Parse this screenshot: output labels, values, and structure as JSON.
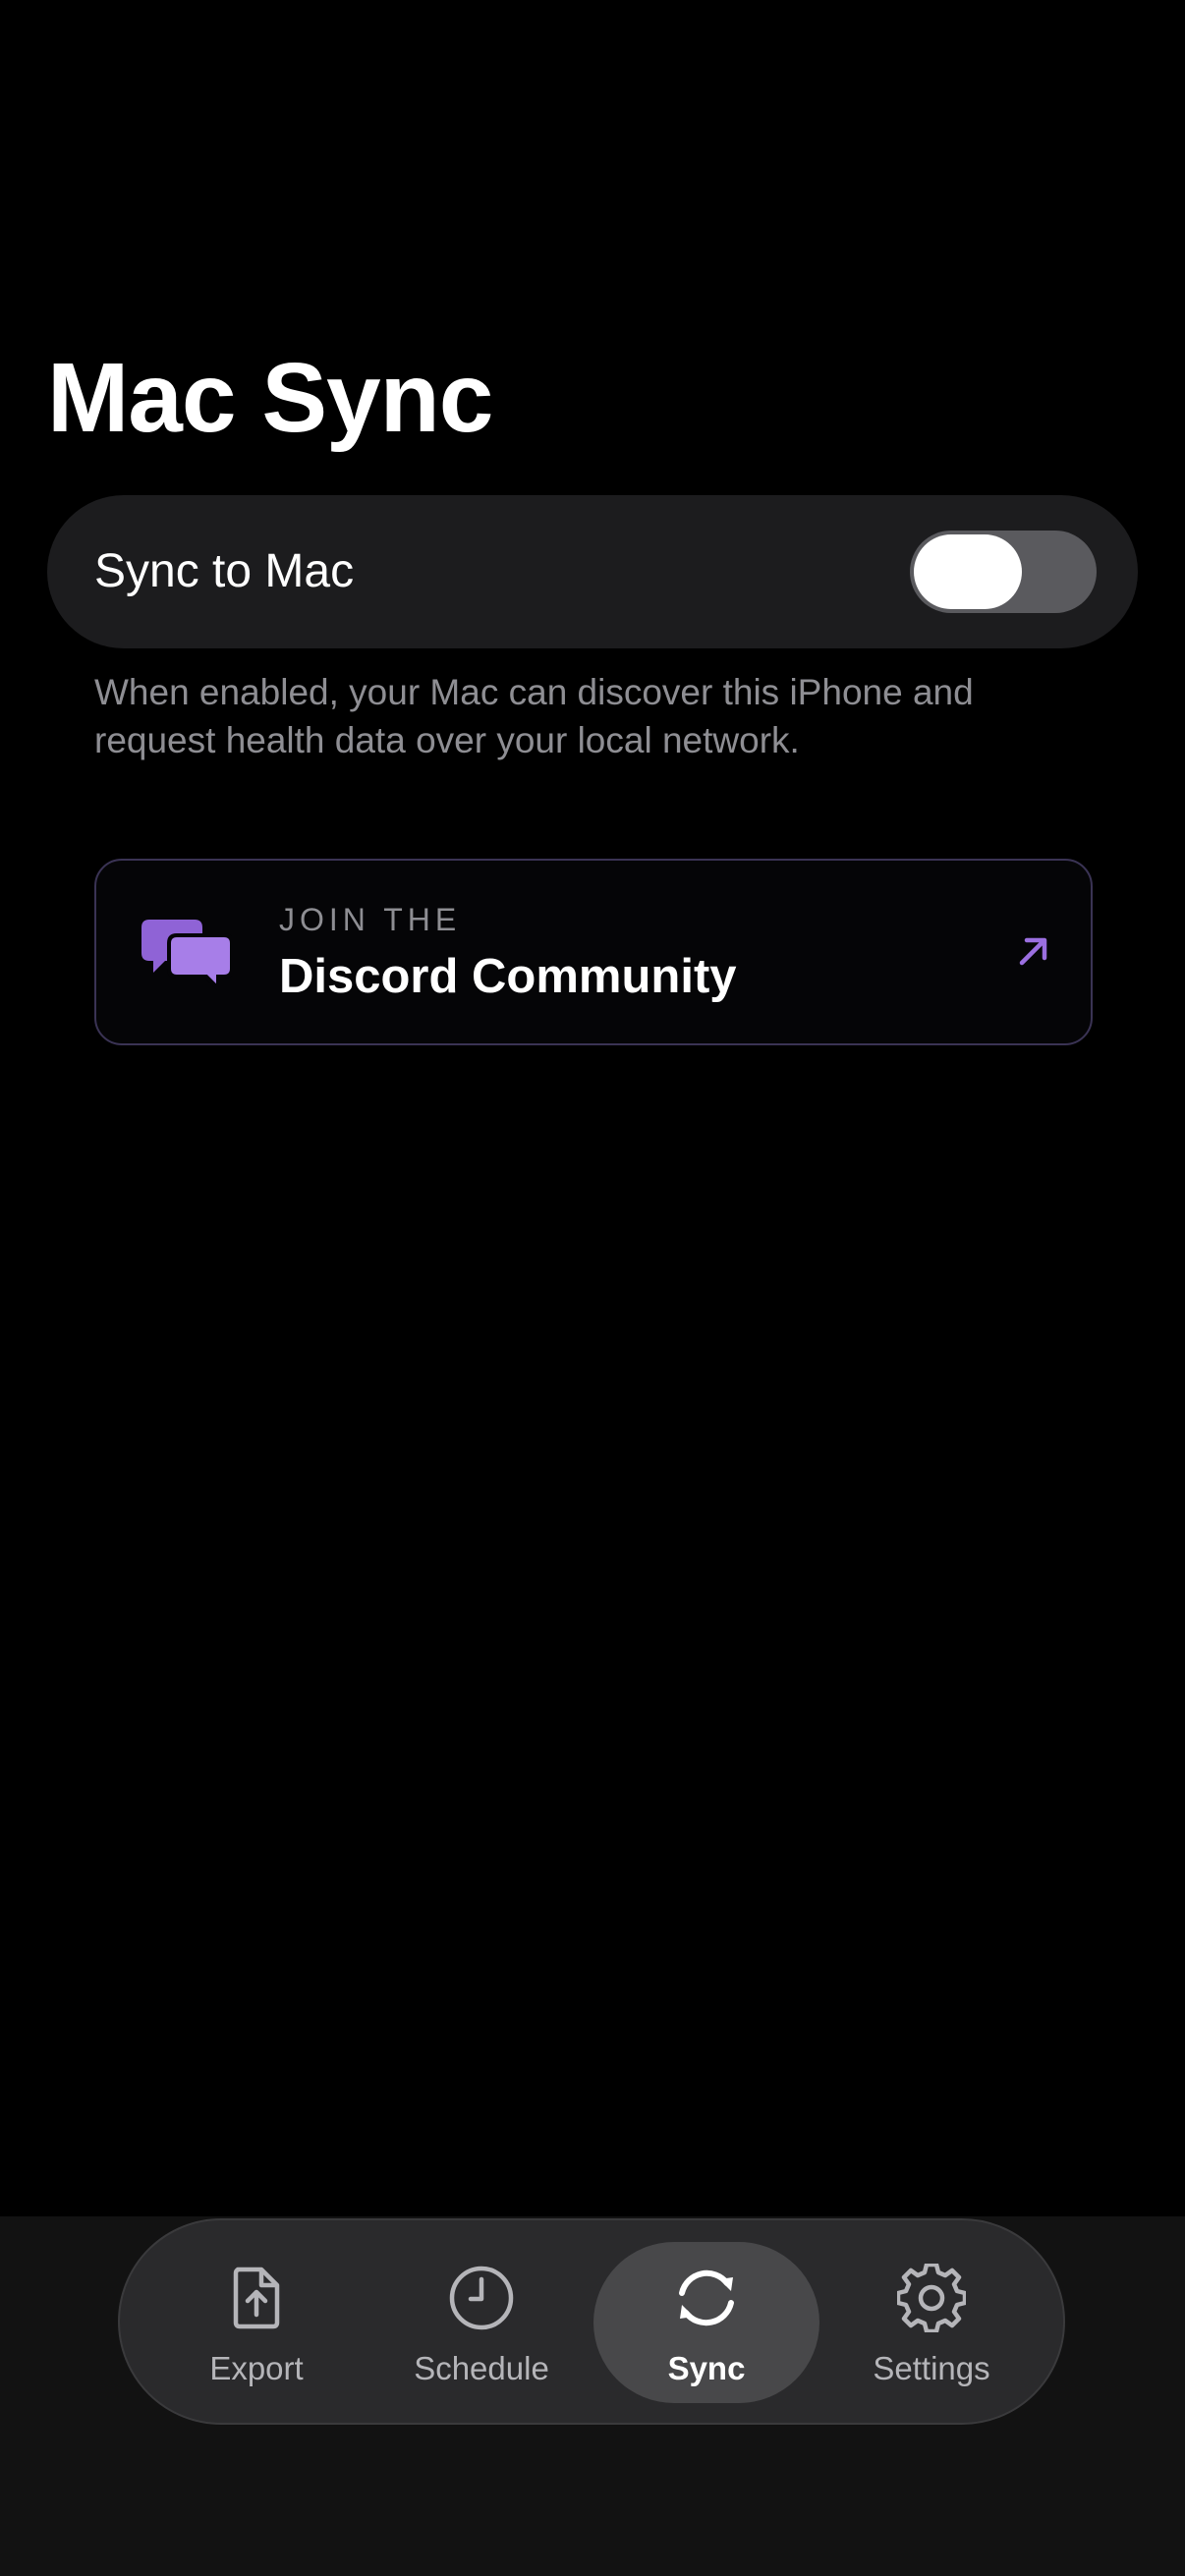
{
  "page": {
    "title": "Mac Sync"
  },
  "sync_setting": {
    "label": "Sync to Mac",
    "enabled": false,
    "footnote": "When enabled, your Mac can discover this iPhone and request health data over your local network."
  },
  "discord": {
    "overline": "JOIN THE",
    "title": "Discord Community",
    "icon": "chat-bubbles-icon",
    "link_icon": "arrow-up-right-icon",
    "accent_color": "#9b6fe0"
  },
  "tab_bar": {
    "active_tab": "Sync",
    "tabs": [
      {
        "label": "Export",
        "icon": "export-document-icon"
      },
      {
        "label": "Schedule",
        "icon": "clock-icon"
      },
      {
        "label": "Sync",
        "icon": "sync-arrows-icon"
      },
      {
        "label": "Settings",
        "icon": "gear-icon"
      }
    ]
  }
}
